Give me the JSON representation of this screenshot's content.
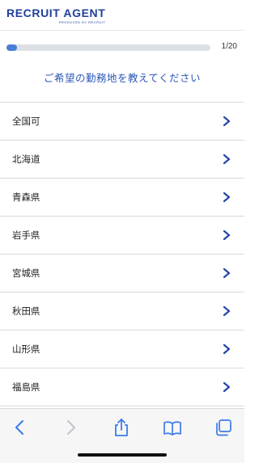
{
  "header": {
    "logo_text": "RECRUIT AGENT",
    "logo_sub": "PRODUCED BY RECRUIT"
  },
  "progress": {
    "current": 1,
    "total": 20,
    "counter_text": "1/20",
    "fraction": 0.05
  },
  "question": "ご希望の勤務地を教えてください",
  "options": [
    {
      "label": "全国可"
    },
    {
      "label": "北海道"
    },
    {
      "label": "青森県"
    },
    {
      "label": "岩手県"
    },
    {
      "label": "宮城県"
    },
    {
      "label": "秋田県"
    },
    {
      "label": "山形県"
    },
    {
      "label": "福島県"
    }
  ],
  "toolbar": {
    "icons": [
      "back-icon",
      "forward-icon",
      "share-icon",
      "bookmarks-icon",
      "tabs-icon"
    ]
  },
  "colors": {
    "brand": "#1f3f9e",
    "accent": "#2a56b8",
    "progress_fill": "#4a7fd6",
    "toolbar_icon": "#3b7be8",
    "toolbar_icon_disabled": "#c0c4cc"
  }
}
